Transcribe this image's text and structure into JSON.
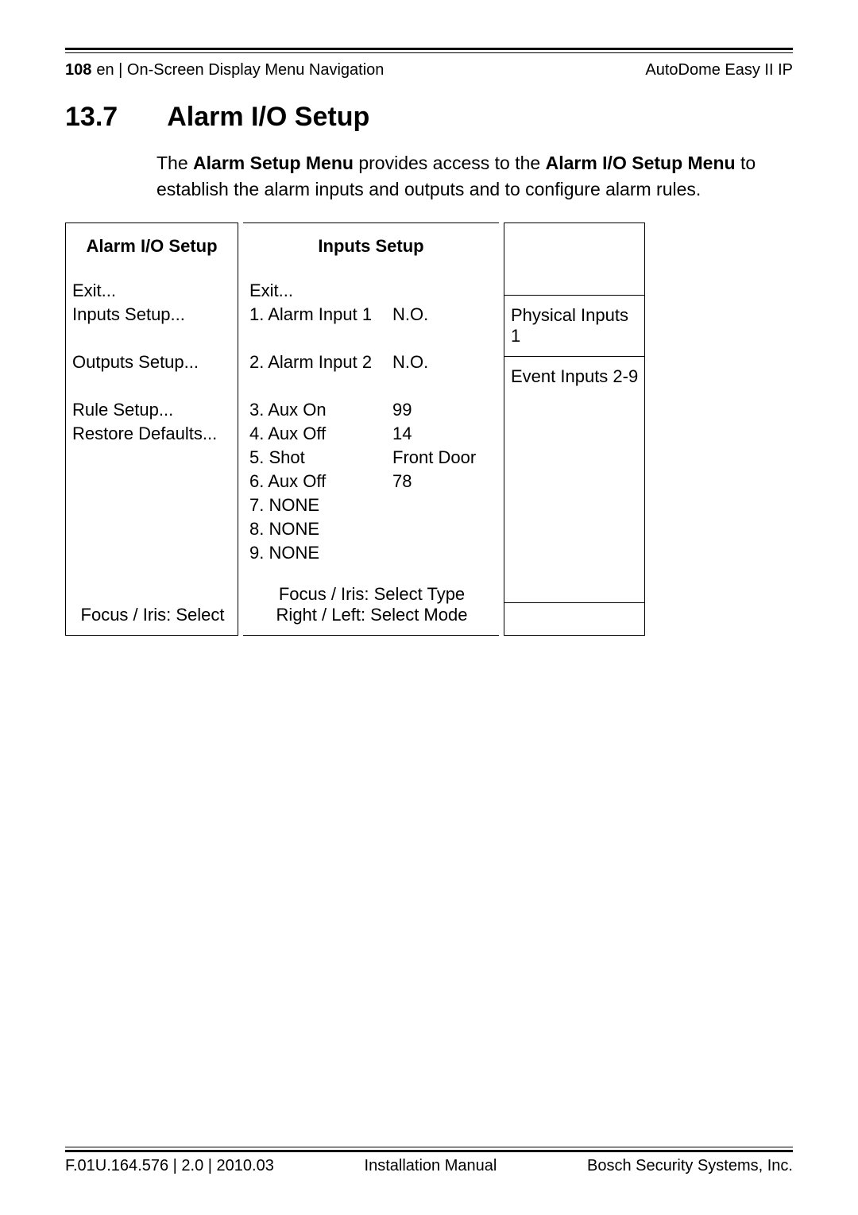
{
  "header": {
    "page_number": "108",
    "breadcrumb": "en | On-Screen Display Menu Navigation",
    "product": "AutoDome Easy II IP"
  },
  "section": {
    "number": "13.7",
    "title": "Alarm I/O Setup"
  },
  "intro": {
    "t1": "The ",
    "b1": "Alarm Setup Menu",
    "t2": " provides access to the ",
    "b2": "Alarm I/O Setup Menu",
    "t3": " to establish the alarm inputs and outputs and to configure alarm rules."
  },
  "col1": {
    "heading": "Alarm I/O Setup",
    "items": {
      "exit": "Exit...",
      "inputs": "Inputs Setup...",
      "outputs": "Outputs Setup...",
      "rule": "Rule Setup...",
      "restore": "Restore Defaults..."
    },
    "footer": "Focus / Iris: Select"
  },
  "col2": {
    "heading": "Inputs Setup",
    "rows": {
      "exit": {
        "label": "Exit..."
      },
      "r1": {
        "label": "1. Alarm Input 1",
        "value": "N.O."
      },
      "r2": {
        "label": "2. Alarm Input 2",
        "value": "N.O."
      },
      "r3": {
        "label": "3. Aux On",
        "value": "99"
      },
      "r4": {
        "label": "4. Aux Off",
        "value": "14"
      },
      "r5": {
        "label": "5. Shot",
        "value": "Front Door"
      },
      "r6": {
        "label": "6. Aux Off",
        "value": "78"
      },
      "r7": {
        "label": "7. NONE"
      },
      "r8": {
        "label": "8. NONE"
      },
      "r9": {
        "label": "9. NONE"
      }
    },
    "footer1": "Focus / Iris: Select Type",
    "footer2": "Right / Left: Select Mode"
  },
  "col3": {
    "c1": "Physical Inputs 1",
    "c2": "Event Inputs 2-9"
  },
  "footer": {
    "left": "F.01U.164.576 | 2.0 | 2010.03",
    "center": "Installation Manual",
    "right": "Bosch Security Systems, Inc."
  }
}
